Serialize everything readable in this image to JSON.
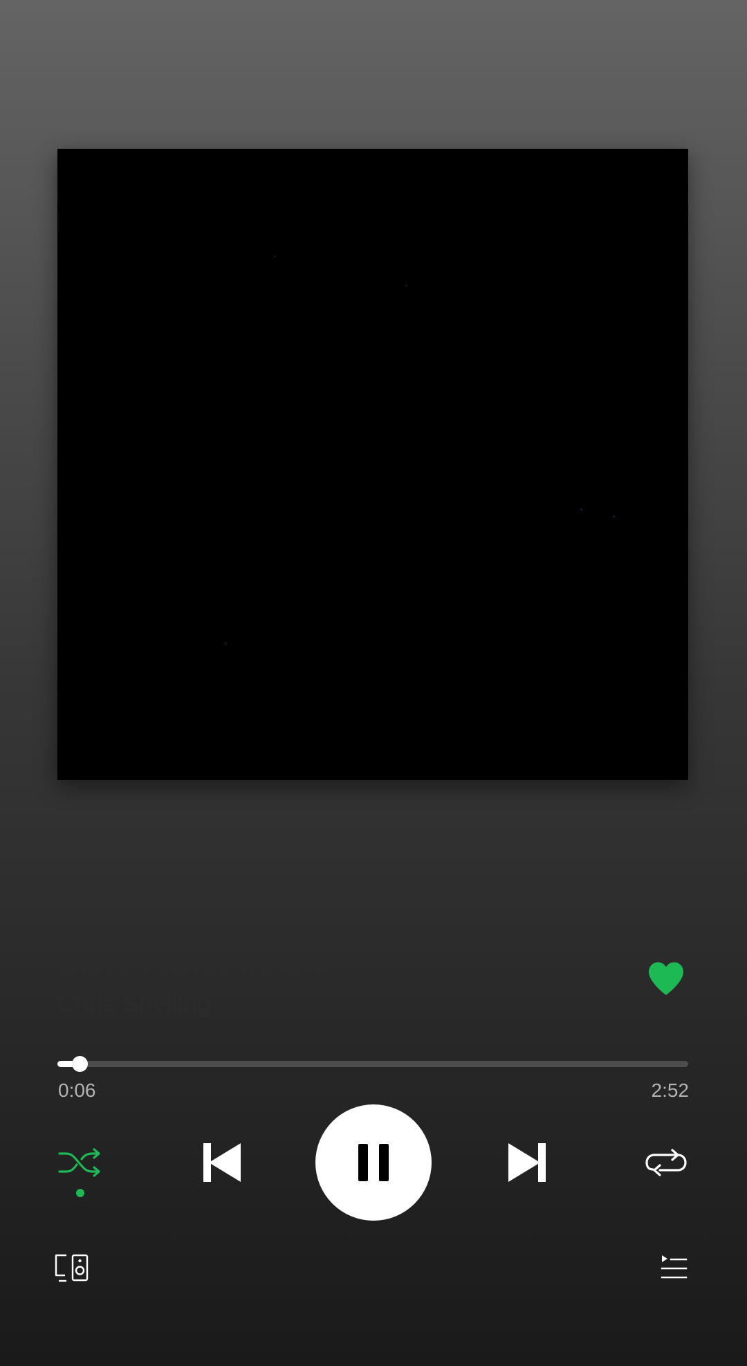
{
  "track": {
    "title": "River Flows in You",
    "artist": "Chris Snelling",
    "liked": true
  },
  "playback": {
    "elapsed": "0:06",
    "duration": "2:52",
    "progress_fraction": 0.035,
    "state": "playing",
    "shuffle_on": true,
    "repeat_on": false
  },
  "icons": {
    "like": "heart-filled-icon",
    "shuffle": "shuffle-icon",
    "previous": "skip-previous-icon",
    "play_pause": "pause-icon",
    "next": "skip-next-icon",
    "repeat": "repeat-icon",
    "devices": "connect-devices-icon",
    "queue": "queue-icon"
  },
  "colors": {
    "accent": "#1db954",
    "primary_text": "#ffffff",
    "secondary_text": "#b3b3b3",
    "progress_bg": "#4d4d4d"
  }
}
